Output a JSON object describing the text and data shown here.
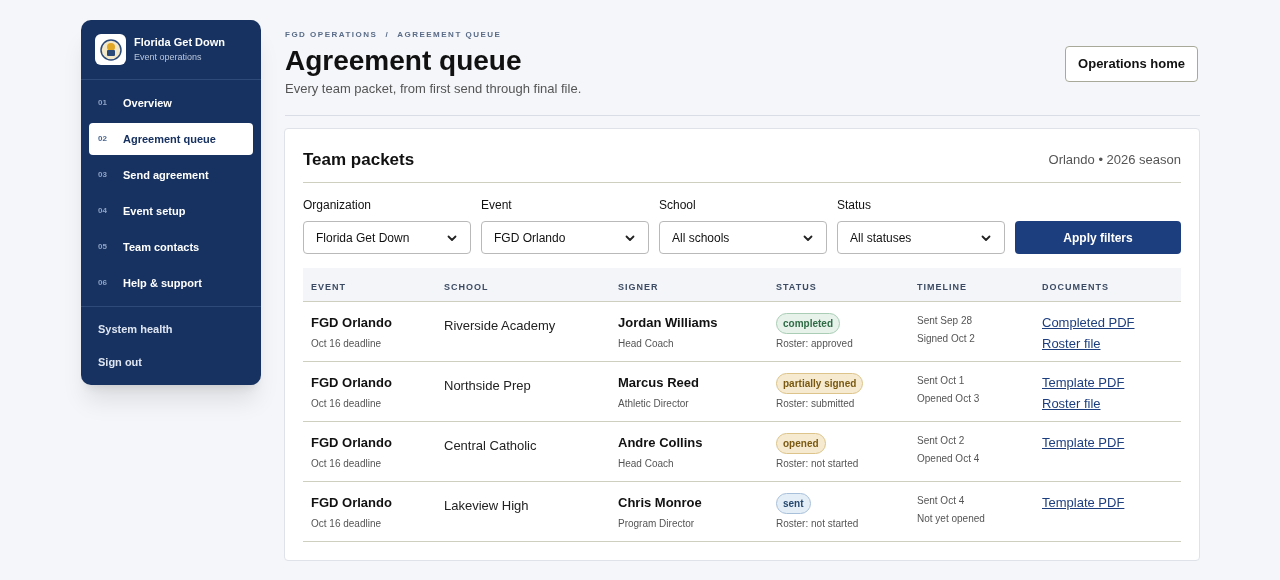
{
  "sidebar": {
    "brand": {
      "name": "Florida Get Down",
      "subtitle": "Event operations"
    },
    "items": [
      {
        "number": "01",
        "label": "Overview",
        "selected": false
      },
      {
        "number": "02",
        "label": "Agreement queue",
        "selected": true
      },
      {
        "number": "03",
        "label": "Send agreement",
        "selected": false
      },
      {
        "number": "04",
        "label": "Event setup",
        "selected": false
      },
      {
        "number": "05",
        "label": "Team contacts",
        "selected": false
      },
      {
        "number": "06",
        "label": "Help & support",
        "selected": false
      }
    ],
    "footer_links": [
      "System health",
      "Sign out"
    ]
  },
  "header": {
    "breadcrumb": [
      "FGD OPERATIONS",
      "AGREEMENT QUEUE"
    ],
    "separator": "/",
    "title": "Agreement queue",
    "subtitle": "Every team packet, from first send through final file.",
    "button": "Operations home"
  },
  "card": {
    "title": "Team packets",
    "meta": "Orlando • 2026 season",
    "filters": [
      {
        "label": "Organization",
        "value": "Florida Get Down"
      },
      {
        "label": "Event",
        "value": "FGD Orlando"
      },
      {
        "label": "School",
        "value": "All schools"
      },
      {
        "label": "Status",
        "value": "All statuses"
      }
    ],
    "apply_button": "Apply filters",
    "table": {
      "columns": [
        "EVENT",
        "SCHOOL",
        "SIGNER",
        "STATUS",
        "TIMELINE",
        "DOCUMENTS"
      ],
      "rows": [
        {
          "event": "FGD Orlando",
          "deadline": "Oct 16 deadline",
          "school": "Riverside Academy",
          "signer": "Jordan Williams",
          "role": "Head Coach",
          "status": "completed",
          "color": "#e6f2ea",
          "roster": "Roster: approved",
          "timeline": [
            "Sent Sep 28",
            "Signed Oct 2"
          ],
          "documents": [
            "Completed PDF",
            "Roster file"
          ]
        },
        {
          "event": "FGD Orlando",
          "deadline": "Oct 16 deadline",
          "school": "Northside Prep",
          "signer": "Marcus Reed",
          "role": "Athletic Director",
          "status": "partially signed",
          "color": "#f6ead0",
          "roster": "Roster: submitted",
          "timeline": [
            "Sent Oct 1",
            "Opened Oct 3"
          ],
          "documents": [
            "Template PDF",
            "Roster file"
          ]
        },
        {
          "event": "FGD Orlando",
          "deadline": "Oct 16 deadline",
          "school": "Central Catholic",
          "signer": "Andre Collins",
          "role": "Head Coach",
          "status": "opened",
          "color": "#f6ead0",
          "roster": "Roster: not started",
          "timeline": [
            "Sent Oct 2",
            "Opened Oct 4"
          ],
          "documents": [
            "Template PDF"
          ]
        },
        {
          "event": "FGD Orlando",
          "deadline": "Oct 16 deadline",
          "school": "Lakeview High",
          "signer": "Chris Monroe",
          "role": "Program Director",
          "status": "sent",
          "color": "#e4eef7",
          "roster": "Roster: not started",
          "timeline": [
            "Sent Oct 4",
            "Not yet opened"
          ],
          "documents": [
            "Template PDF"
          ]
        }
      ]
    }
  }
}
